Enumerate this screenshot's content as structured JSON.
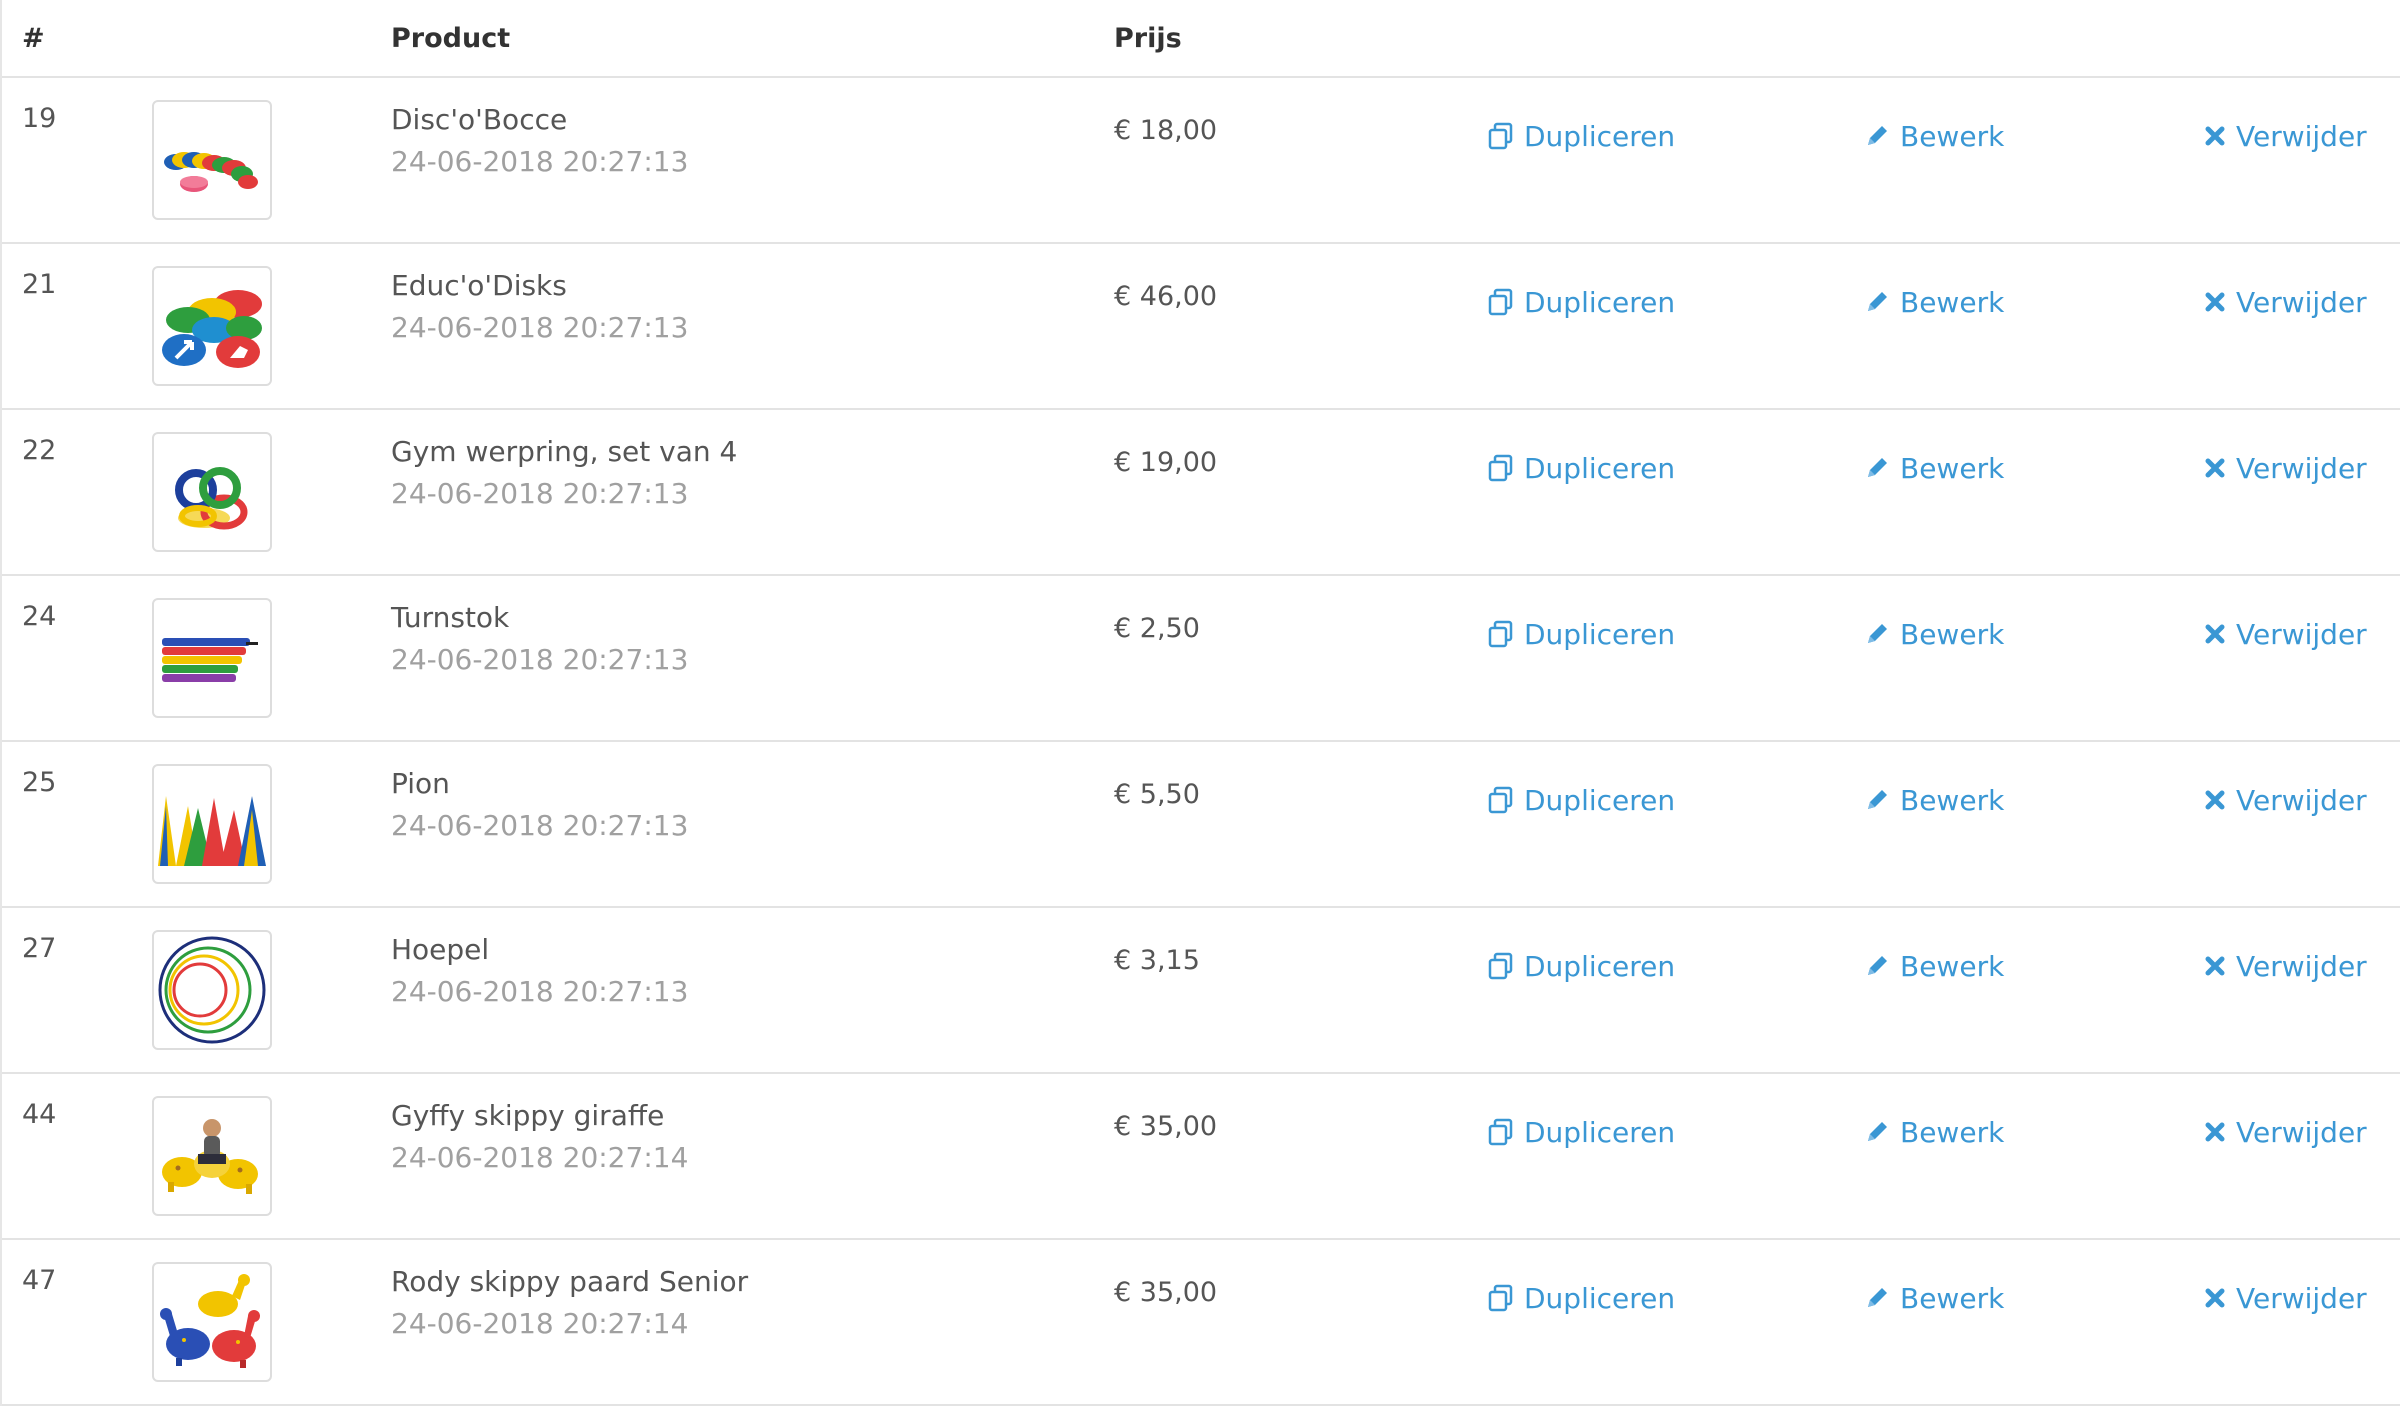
{
  "table": {
    "headers": {
      "num": "#",
      "product": "Product",
      "price": "Prijs"
    },
    "actions": {
      "duplicate": "Dupliceren",
      "edit": "Bewerk",
      "delete": "Verwijder"
    },
    "rows": [
      {
        "id": "19",
        "name": "Disc'o'Bocce",
        "date": "24-06-2018 20:27:13",
        "price": "€ 18,00",
        "thumb": "disc-bocce-image"
      },
      {
        "id": "21",
        "name": "Educ'o'Disks",
        "date": "24-06-2018 20:27:13",
        "price": "€ 46,00",
        "thumb": "educ-disks-image"
      },
      {
        "id": "22",
        "name": "Gym werpring, set van 4",
        "date": "24-06-2018 20:27:13",
        "price": "€ 19,00",
        "thumb": "throw-rings-image"
      },
      {
        "id": "24",
        "name": "Turnstok",
        "date": "24-06-2018 20:27:13",
        "price": "€ 2,50",
        "thumb": "gym-sticks-image"
      },
      {
        "id": "25",
        "name": "Pion",
        "date": "24-06-2018 20:27:13",
        "price": "€ 5,50",
        "thumb": "cones-image"
      },
      {
        "id": "27",
        "name": "Hoepel",
        "date": "24-06-2018 20:27:13",
        "price": "€ 3,15",
        "thumb": "hoops-image"
      },
      {
        "id": "44",
        "name": "Gyffy skippy giraffe",
        "date": "24-06-2018 20:27:14",
        "price": "€ 35,00",
        "thumb": "skippy-giraffe-image"
      },
      {
        "id": "47",
        "name": "Rody skippy paard Senior",
        "date": "24-06-2018 20:27:14",
        "price": "€ 35,00",
        "thumb": "skippy-horse-image"
      }
    ]
  },
  "colors": {
    "link": "#3a97d4",
    "text": "#555555",
    "muted": "#a0a0a0",
    "border": "#e3e3e3"
  }
}
